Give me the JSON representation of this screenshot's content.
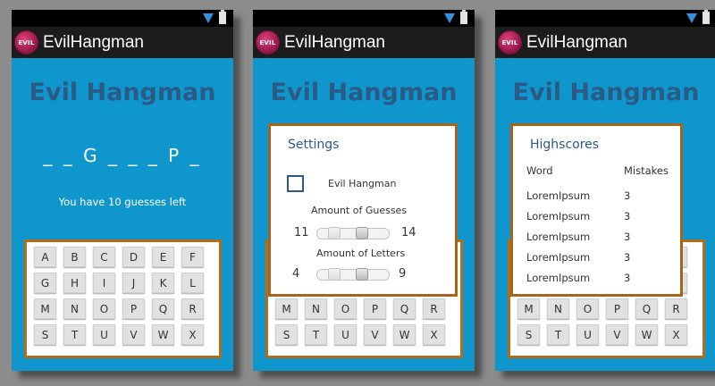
{
  "app": {
    "name": "EvilHangman",
    "logo_text": "EVIL"
  },
  "game": {
    "title": "Evil Hangman",
    "word_display": "_ _ G _ _ _ P _",
    "guesses_text": "You have 10 guesses left"
  },
  "keyboard": {
    "rows": [
      [
        "A",
        "B",
        "C",
        "D",
        "E",
        "F"
      ],
      [
        "G",
        "H",
        "I",
        "J",
        "K",
        "L"
      ],
      [
        "M",
        "N",
        "O",
        "P",
        "Q",
        "R"
      ],
      [
        "S",
        "T",
        "U",
        "V",
        "W",
        "X"
      ]
    ]
  },
  "settings": {
    "title": "Settings",
    "evil_label": "Evil Hangman",
    "evil_checked": false,
    "guesses_label": "Amount of Guesses",
    "guesses_min": "11",
    "guesses_max": "14",
    "letters_label": "Amount of Letters",
    "letters_min": "4",
    "letters_max": "9"
  },
  "highscores": {
    "title": "Highscores",
    "col_word": "Word",
    "col_mistakes": "Mistakes",
    "rows": [
      {
        "word": "LoremIpsum",
        "mistakes": "3"
      },
      {
        "word": "LoremIpsum",
        "mistakes": "3"
      },
      {
        "word": "LoremIpsum",
        "mistakes": "3"
      },
      {
        "word": "LoremIpsum",
        "mistakes": "3"
      },
      {
        "word": "LoremIpsum",
        "mistakes": "3"
      }
    ]
  },
  "colors": {
    "background": "#0f96cc",
    "title": "#2a5b86",
    "frame": "#b56b17"
  }
}
